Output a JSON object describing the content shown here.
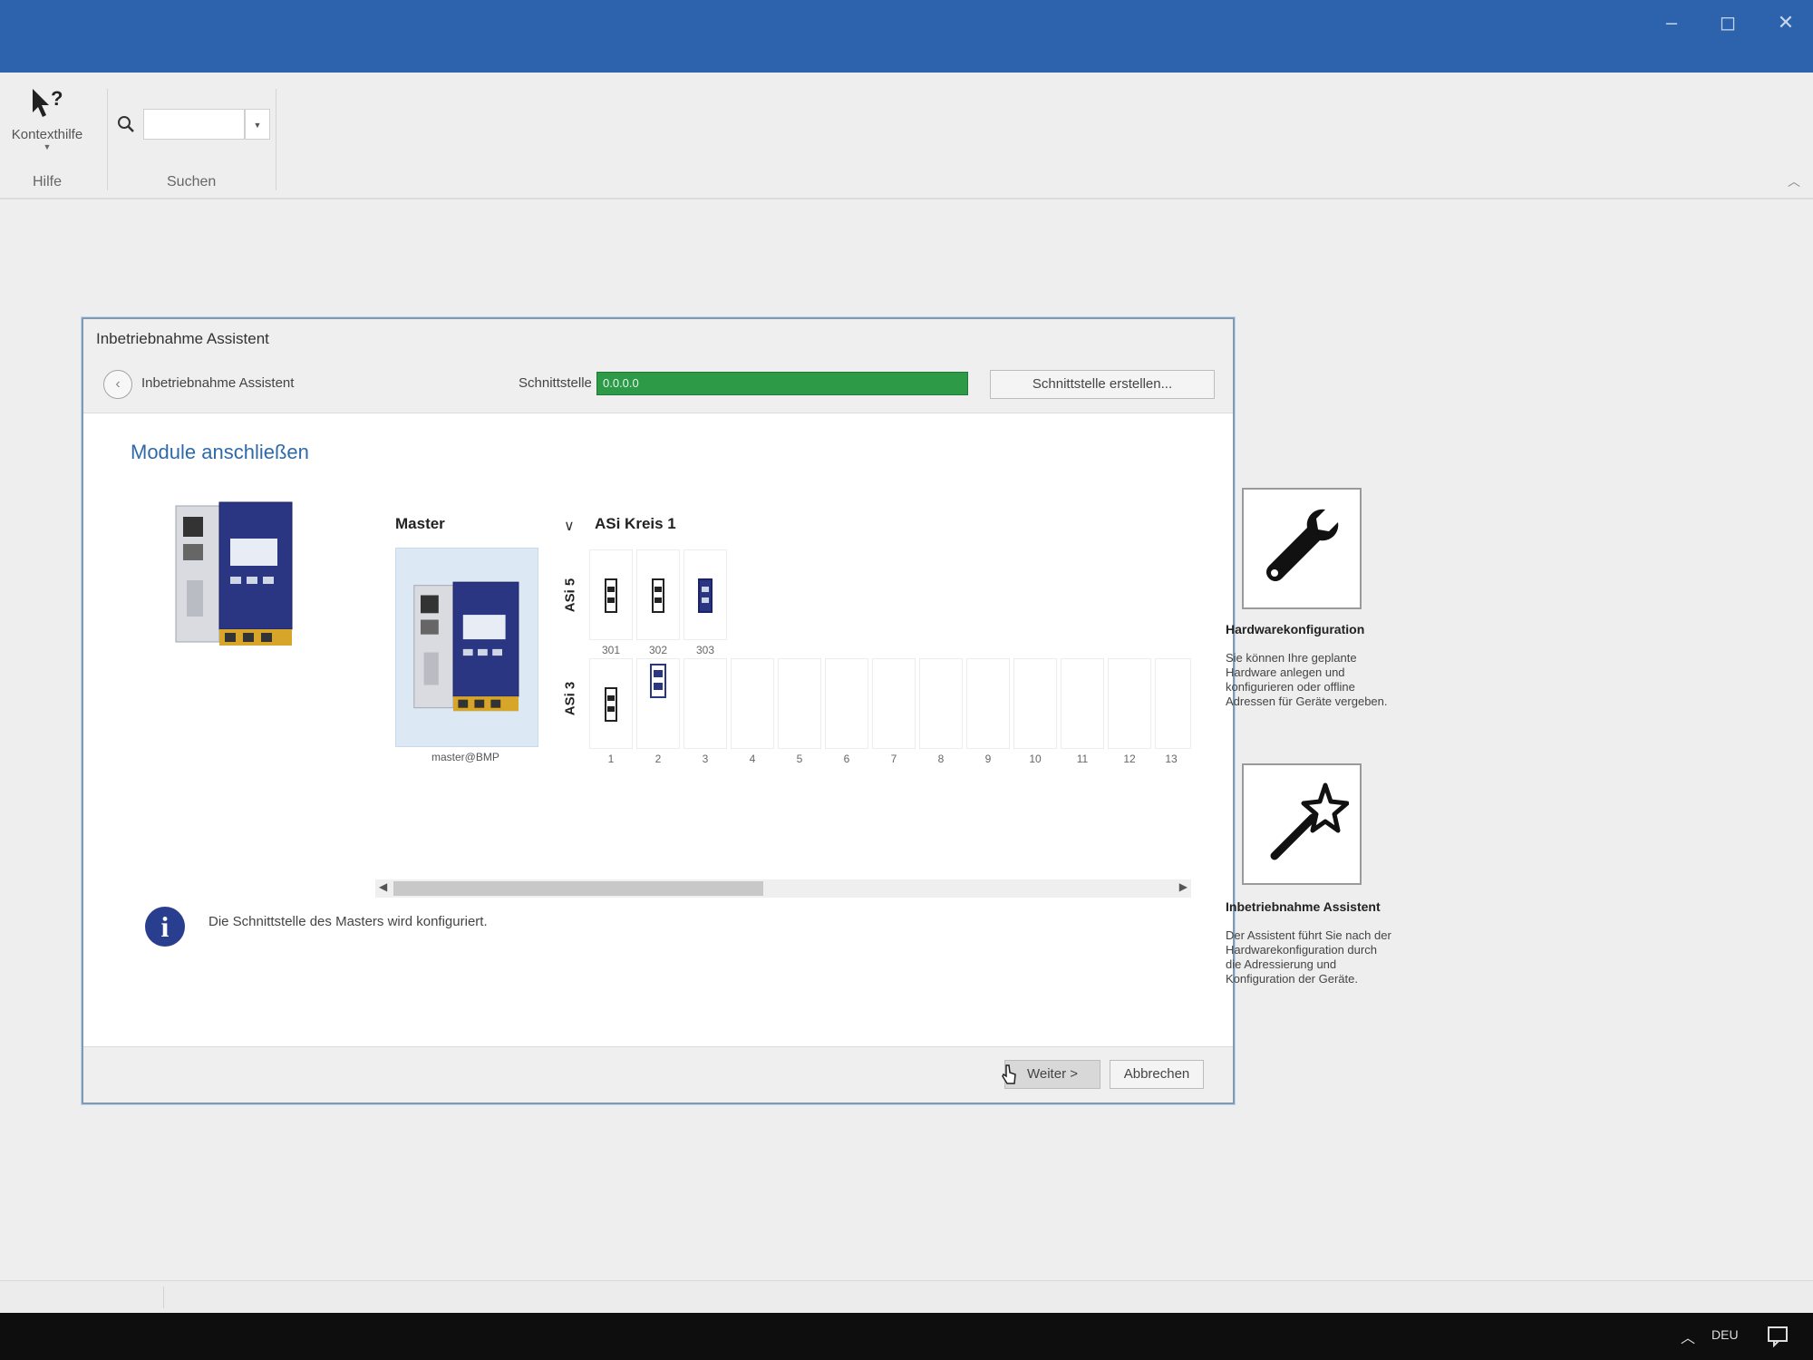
{
  "window": {
    "controls": {
      "minimize": "–",
      "maximize": "◻",
      "close": "✕"
    }
  },
  "ribbon": {
    "help_button": {
      "label": "Kontexthilfe",
      "icon": "pointer-question-icon"
    },
    "help_group": "Hilfe",
    "search": {
      "value": "",
      "placeholder": "",
      "icon": "search-icon"
    },
    "search_group": "Suchen",
    "collapse": "︿"
  },
  "dialog": {
    "title": "Inbetriebnahme Assistent",
    "breadcrumb": "Inbetriebnahme Assistent",
    "back_icon": "‹",
    "interface_label": "Schnittstelle",
    "interface_value": "0.0.0.0",
    "interface_button": "Schnittstelle erstellen...",
    "heading": "Module anschließen",
    "master_label": "Master",
    "master_sub": "master@BMP",
    "circuit_label": "ASi Kreis 1",
    "row_a_label": "ASi 5",
    "row_b_label": "ASi 3",
    "row_a_addresses": [
      "301",
      "302",
      "303"
    ],
    "slot_numbers": [
      "1",
      "2",
      "3",
      "4",
      "5",
      "6",
      "7",
      "8",
      "9",
      "10",
      "11",
      "12",
      "13"
    ],
    "info_icon": "i",
    "info_text": "Die Schnittstelle des Masters wird konfiguriert.",
    "next_button": "Weiter >",
    "cancel_button": "Abbrechen"
  },
  "side": {
    "panel1": {
      "icon": "wrench-icon",
      "title": "Hardwarekonfiguration",
      "desc": [
        "Sie können Ihre geplante",
        "Hardware anlegen und",
        "konfigurieren oder offline",
        "Adressen für Geräte vergeben."
      ]
    },
    "panel2": {
      "icon": "magic-wand-icon",
      "title": "Inbetriebnahme Assistent",
      "desc": [
        "Der Assistent führt Sie nach der",
        "Hardwarekonfiguration durch",
        "die Adressierung und",
        "Konfiguration der Geräte."
      ]
    }
  },
  "taskbar": {
    "language": "DEU",
    "tray_icon": "chevron-up-icon",
    "notification_icon": "notification-icon"
  },
  "colors": {
    "titlebar": "#2d63ad",
    "interface_bar": "#2d9a48",
    "heading": "#2f6aa8",
    "info_icon": "#2a3e8f"
  }
}
